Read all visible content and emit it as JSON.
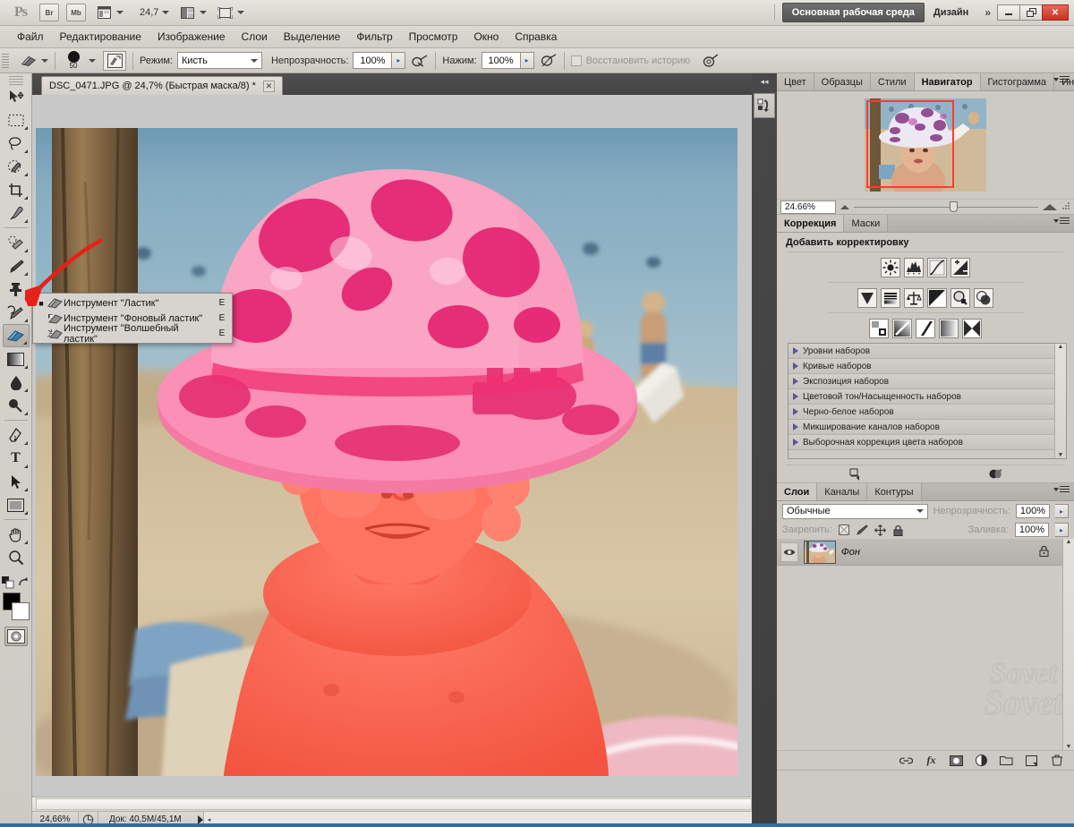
{
  "app": {
    "logo": "Ps",
    "launch_buttons": [
      "Br",
      "Mb"
    ],
    "screen_mode_label": "",
    "zoom_level": "24,7",
    "workspace_active": "Основная рабочая среда",
    "workspace_secondary": "Дизайн",
    "more_workspaces": "»",
    "window_controls": {
      "minimize": "—",
      "restore": "❐",
      "close": "✕"
    }
  },
  "menubar": {
    "items": [
      "Файл",
      "Редактирование",
      "Изображение",
      "Слои",
      "Выделение",
      "Фильтр",
      "Просмотр",
      "Окно",
      "Справка"
    ]
  },
  "options_bar": {
    "tool_icon": "eraser-icon",
    "brush_size": "50",
    "brush_panel_icon": "brush-panel-icon",
    "mode_label": "Режим:",
    "mode_value": "Кисть",
    "opacity_label": "Непрозрачность:",
    "opacity_value": "100%",
    "airbrush_icon": "airbrush-icon",
    "flow_label": "Нажим:",
    "flow_value": "100%",
    "pressure_icon": "pressure-icon",
    "history_checkbox_label": "Восстановить историю",
    "tablet_icon": "tablet-pressure-icon"
  },
  "toolbox": {
    "tools": [
      {
        "name": "move-tool",
        "icon": "move-arrow-icon",
        "has_submenu": false
      },
      {
        "name": "marquee-tool",
        "icon": "rect-marquee-icon",
        "has_submenu": true
      },
      {
        "name": "lasso-tool",
        "icon": "lasso-icon",
        "has_submenu": true
      },
      {
        "name": "quick-selection-tool",
        "icon": "quick-select-icon",
        "has_submenu": true
      },
      {
        "name": "crop-tool",
        "icon": "crop-icon",
        "has_submenu": true
      },
      {
        "name": "eyedropper-tool",
        "icon": "eyedropper-icon",
        "has_submenu": true
      },
      {
        "name": "spot-healing-tool",
        "icon": "healing-brush-icon",
        "has_submenu": true
      },
      {
        "name": "brush-tool",
        "icon": "paintbrush-icon",
        "has_submenu": true
      },
      {
        "name": "clone-stamp-tool",
        "icon": "stamp-icon",
        "has_submenu": true
      },
      {
        "name": "history-brush-tool",
        "icon": "history-brush-icon",
        "has_submenu": true
      },
      {
        "name": "eraser-tool",
        "icon": "eraser-icon",
        "has_submenu": true,
        "selected": true
      },
      {
        "name": "gradient-tool",
        "icon": "gradient-icon",
        "has_submenu": true
      },
      {
        "name": "blur-tool",
        "icon": "water-drop-icon",
        "has_submenu": true
      },
      {
        "name": "dodge-tool",
        "icon": "dodge-icon",
        "has_submenu": true
      },
      {
        "name": "pen-tool",
        "icon": "pen-icon",
        "has_submenu": true
      },
      {
        "name": "type-tool",
        "icon": "text-T-icon",
        "has_submenu": true
      },
      {
        "name": "path-selection-tool",
        "icon": "path-arrow-icon",
        "has_submenu": true
      },
      {
        "name": "shape-tool",
        "icon": "rectangle-shape-icon",
        "has_submenu": true
      },
      {
        "name": "hand-tool",
        "icon": "hand-icon",
        "has_submenu": true
      },
      {
        "name": "zoom-tool",
        "icon": "magnifier-icon",
        "has_submenu": false
      }
    ],
    "foreground_color": "#000000",
    "background_color": "#ffffff",
    "quickmask_label": "quick-mask-toggle"
  },
  "tool_flyout": {
    "items": [
      {
        "label": "Инструмент \"Ластик\"",
        "shortcut": "E",
        "selected": true,
        "icon": "eraser-icon"
      },
      {
        "label": "Инструмент \"Фоновый ластик\"",
        "shortcut": "E",
        "selected": false,
        "icon": "background-eraser-icon"
      },
      {
        "label": "Инструмент \"Волшебный ластик\"",
        "shortcut": "E",
        "selected": false,
        "icon": "magic-eraser-icon"
      }
    ]
  },
  "document": {
    "tab_title": "DSC_0471.JPG @ 24,7% (Быстрая маска/8) *",
    "close_label": "✕"
  },
  "status_bar": {
    "zoom": "24,66%",
    "doc_info": "Док: 40,5M/45,1M"
  },
  "navigator_panel": {
    "tabs": [
      "Цвет",
      "Образцы",
      "Стили",
      "Навигатор",
      "Гистограмма",
      "Инфо"
    ],
    "active_tab": "Навигатор",
    "zoom_value": "24.66%",
    "view_box_color": "#ff3b2f"
  },
  "adjustments_panel": {
    "tabs": [
      "Коррекция",
      "Маски"
    ],
    "active_tab": "Коррекция",
    "title": "Добавить корректировку",
    "icons_row1": [
      "brightness-contrast-icon",
      "levels-icon",
      "curves-icon",
      "exposure-icon"
    ],
    "icons_row2": [
      "vibrance-icon",
      "hue-saturation-icon",
      "color-balance-icon",
      "black-white-icon",
      "photo-filter-icon",
      "channel-mixer-icon"
    ],
    "icons_row3": [
      "invert-icon",
      "posterize-icon",
      "threshold-icon",
      "gradient-map-icon",
      "selective-color-icon"
    ],
    "presets": [
      "Уровни наборов",
      "Кривые наборов",
      "Экспозиция наборов",
      "Цветовой тон/Насыщенность наборов",
      "Черно-белое наборов",
      "Микширование каналов наборов",
      "Выборочная коррекция цвета наборов"
    ],
    "footer_icons": [
      "clip-to-layer-icon",
      "view-previous-state-icon"
    ]
  },
  "layers_panel": {
    "tabs": [
      "Слои",
      "Каналы",
      "Контуры"
    ],
    "active_tab": "Слои",
    "blend_mode": "Обычные",
    "opacity_label": "Непрозрачность:",
    "opacity_value": "100%",
    "lock_label": "Закрепить:",
    "lock_icons": [
      "lock-transparency-icon",
      "lock-image-icon",
      "lock-position-icon",
      "lock-all-icon"
    ],
    "fill_label": "Заливка:",
    "fill_value": "100%",
    "layers": [
      {
        "name": "Фон",
        "visible": true,
        "locked": true,
        "thumb": "photo-thumb"
      }
    ],
    "footer_icons": [
      "link-layers-icon",
      "layer-style-fx-icon",
      "add-mask-icon",
      "new-fill-adjustment-icon",
      "new-group-icon",
      "new-layer-icon",
      "delete-layer-icon"
    ]
  },
  "watermark": {
    "line1": "Sovet",
    "line2": "Sovet"
  },
  "collapsed_dock": {
    "collapse_icon": "double-chevron-left-icon",
    "button_icon": "history-actions-icon"
  }
}
